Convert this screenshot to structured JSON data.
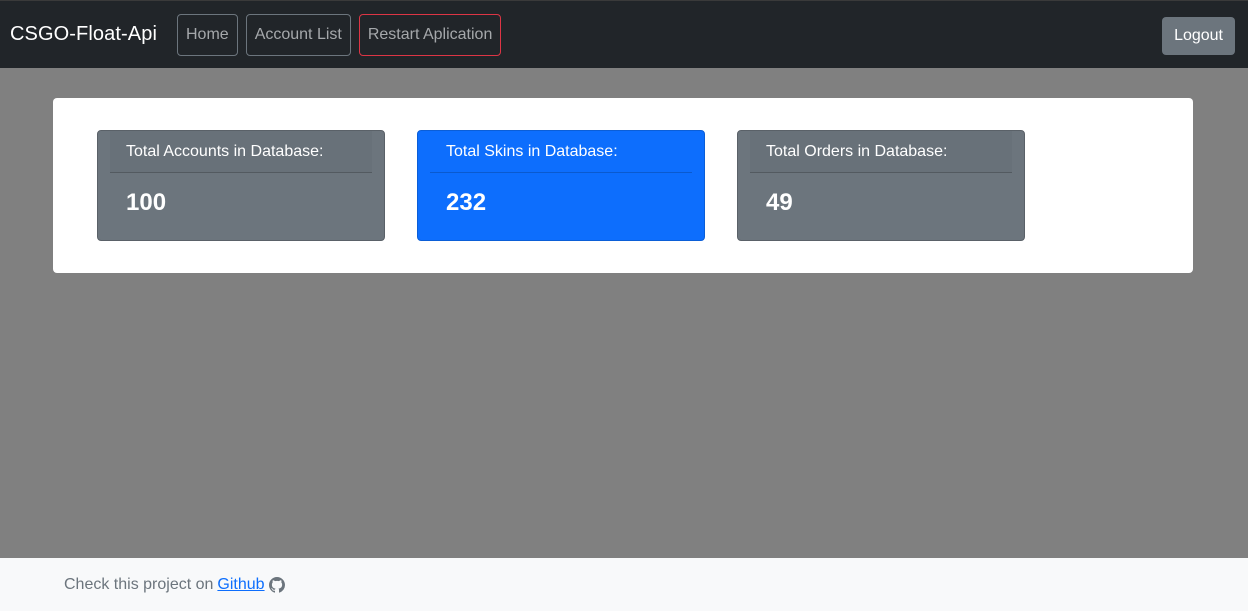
{
  "navbar": {
    "brand": "CSGO-Float-Api",
    "links": [
      "Home",
      "Account List"
    ],
    "restart_label": "Restart Aplication",
    "logout_label": "Logout"
  },
  "stats": [
    {
      "label": "Total Accounts in Database:",
      "value": "100",
      "color": "#6c757d"
    },
    {
      "label": "Total Skins in Database:",
      "value": "232",
      "color": "#0d6efd"
    },
    {
      "label": "Total Orders in Database:",
      "value": "49",
      "color": "#6c757d"
    }
  ],
  "footer": {
    "text": "Check this project on",
    "link_label": "Github",
    "icon": "github-icon"
  }
}
